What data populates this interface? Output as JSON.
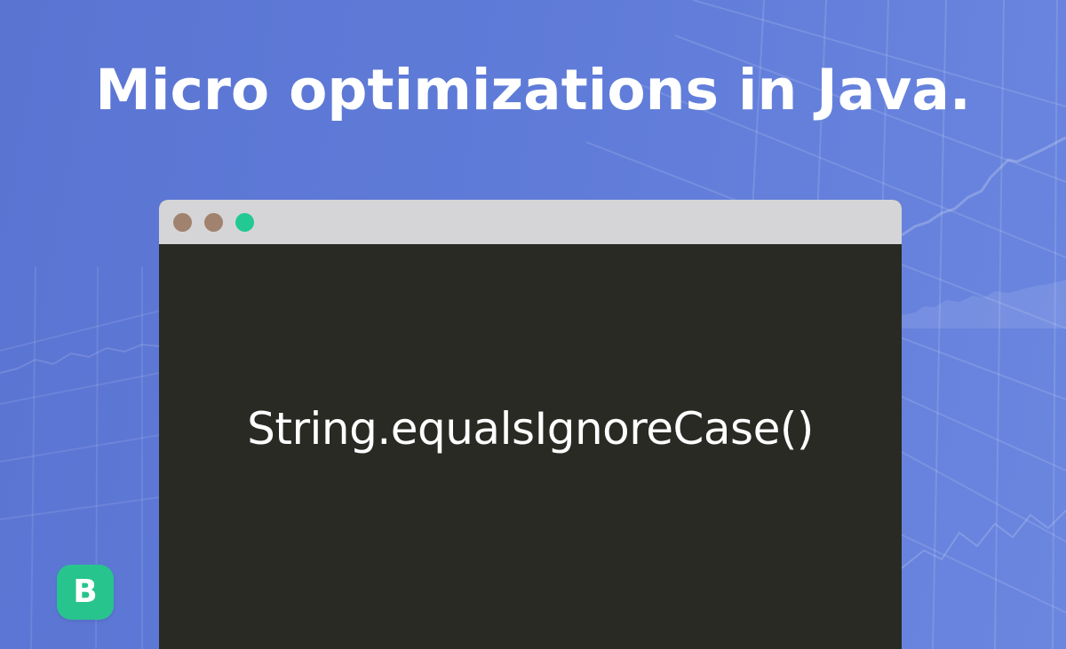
{
  "headline": "Micro optimizations in Java.",
  "code_window": {
    "buttons": [
      "close-dot",
      "minimize-dot",
      "maximize-dot"
    ],
    "code": "String.equalsIgnoreCase()"
  },
  "logo": {
    "letter": "B"
  },
  "colors": {
    "background": "#5f7bd8",
    "titlebar": "#d5d5d7",
    "editor": "#2a2a24",
    "dot_brown": "#a0826e",
    "dot_green": "#22c993",
    "logo": "#28c48d",
    "text": "#ffffff"
  }
}
